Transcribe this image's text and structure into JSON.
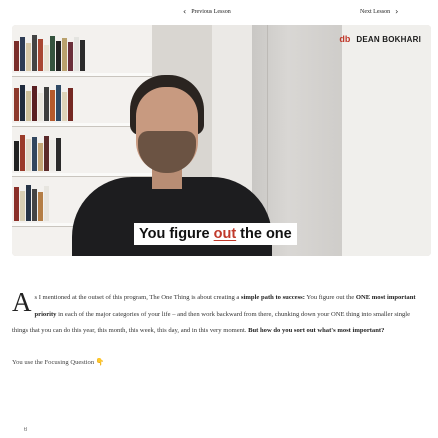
{
  "nav": {
    "prev_label": "Previous Lesson",
    "next_label": "Next Lesson"
  },
  "video": {
    "brand_logo": "db",
    "brand_name": "DEAN BOKHARI",
    "caption_before": "You figure",
    "caption_highlight": "out",
    "caption_after": "the one",
    "highlight_color": "#c0392b"
  },
  "article": {
    "dropcap": "A",
    "p1_a": "s I mentioned at the outset of this program, ",
    "p1_b": "The One Thing",
    "p1_c": " is about creating a ",
    "p1_d": "simple path to success:",
    "p1_e": " You figure out the ",
    "p1_f": "ONE most important priority",
    "p1_g": " in each of the major categories of your life – and then work backward from there, chunking down your ONE thing into smaller single things that you can do this year, this month, this week, this day, and in this very moment. ",
    "p1_h": "But how do you sort out what's most important?",
    "p2": "You use the Focusing Question",
    "p2_icon": "pointing-hand-icon"
  },
  "footer": {
    "mark": "tl"
  }
}
